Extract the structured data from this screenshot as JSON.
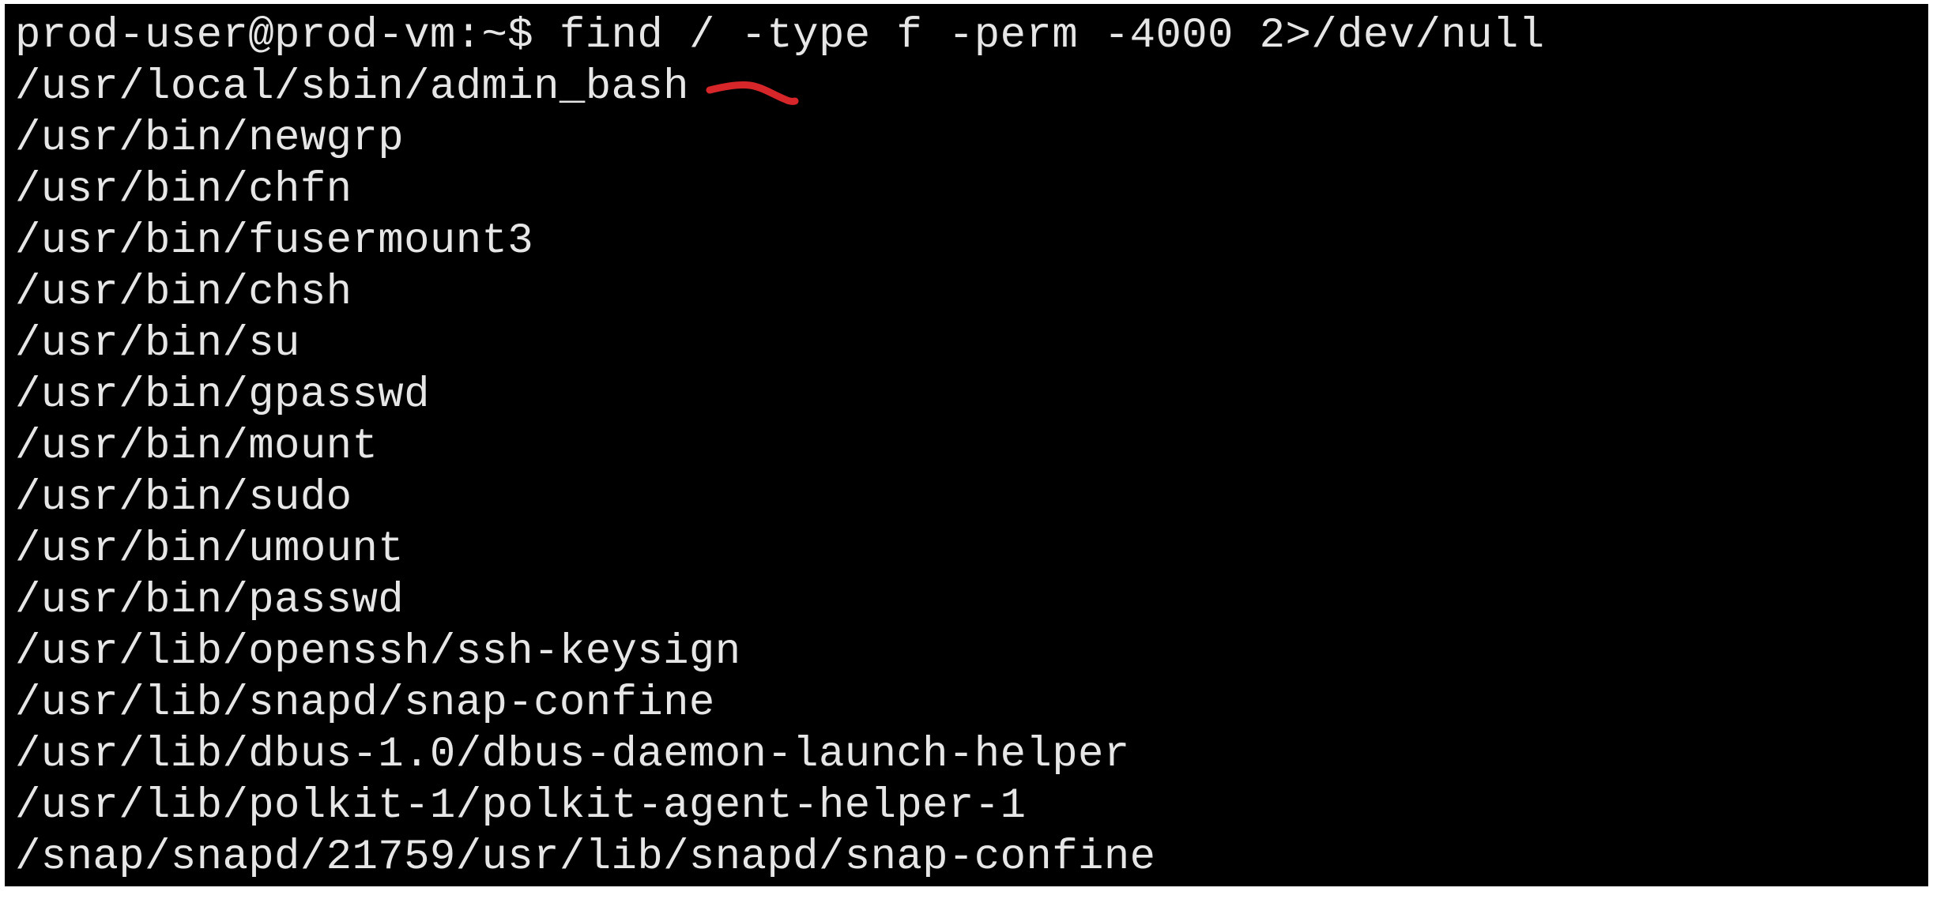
{
  "terminal": {
    "prompt": "prod-user@prod-vm:~$ ",
    "command": "find / -type f -perm -4000 2>/dev/null",
    "output": [
      "/usr/local/sbin/admin_bash",
      "/usr/bin/newgrp",
      "/usr/bin/chfn",
      "/usr/bin/fusermount3",
      "/usr/bin/chsh",
      "/usr/bin/su",
      "/usr/bin/gpasswd",
      "/usr/bin/mount",
      "/usr/bin/sudo",
      "/usr/bin/umount",
      "/usr/bin/passwd",
      "/usr/lib/openssh/ssh-keysign",
      "/usr/lib/snapd/snap-confine",
      "/usr/lib/dbus-1.0/dbus-daemon-launch-helper",
      "/usr/lib/polkit-1/polkit-agent-helper-1",
      "/snap/snapd/21759/usr/lib/snapd/snap-confine"
    ],
    "colors": {
      "background": "#000000",
      "text": "#e6e6e6",
      "annotation": "#d6262a"
    }
  }
}
